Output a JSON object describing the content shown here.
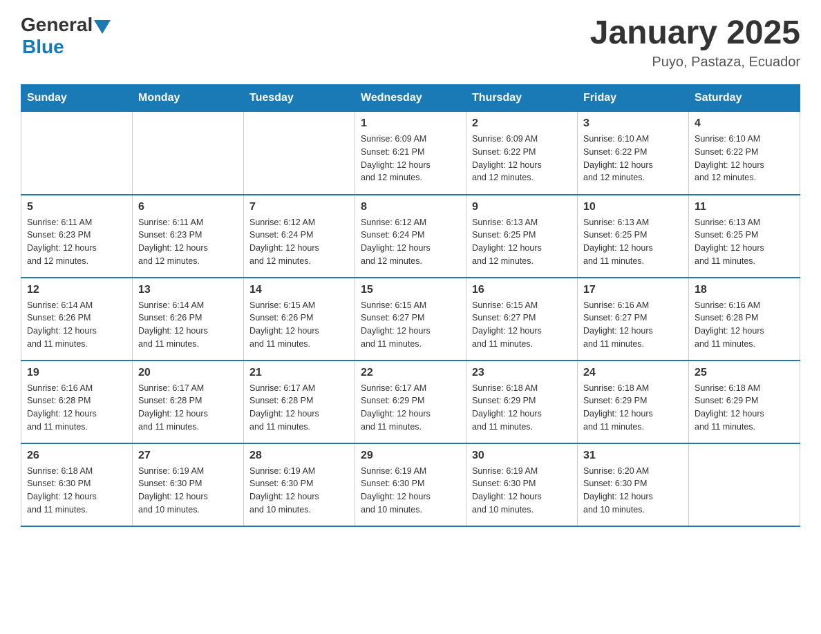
{
  "header": {
    "logo_general": "General",
    "logo_blue": "Blue",
    "title": "January 2025",
    "subtitle": "Puyo, Pastaza, Ecuador"
  },
  "days_of_week": [
    "Sunday",
    "Monday",
    "Tuesday",
    "Wednesday",
    "Thursday",
    "Friday",
    "Saturday"
  ],
  "weeks": [
    {
      "days": [
        {
          "number": "",
          "info": ""
        },
        {
          "number": "",
          "info": ""
        },
        {
          "number": "",
          "info": ""
        },
        {
          "number": "1",
          "info": "Sunrise: 6:09 AM\nSunset: 6:21 PM\nDaylight: 12 hours\nand 12 minutes."
        },
        {
          "number": "2",
          "info": "Sunrise: 6:09 AM\nSunset: 6:22 PM\nDaylight: 12 hours\nand 12 minutes."
        },
        {
          "number": "3",
          "info": "Sunrise: 6:10 AM\nSunset: 6:22 PM\nDaylight: 12 hours\nand 12 minutes."
        },
        {
          "number": "4",
          "info": "Sunrise: 6:10 AM\nSunset: 6:22 PM\nDaylight: 12 hours\nand 12 minutes."
        }
      ]
    },
    {
      "days": [
        {
          "number": "5",
          "info": "Sunrise: 6:11 AM\nSunset: 6:23 PM\nDaylight: 12 hours\nand 12 minutes."
        },
        {
          "number": "6",
          "info": "Sunrise: 6:11 AM\nSunset: 6:23 PM\nDaylight: 12 hours\nand 12 minutes."
        },
        {
          "number": "7",
          "info": "Sunrise: 6:12 AM\nSunset: 6:24 PM\nDaylight: 12 hours\nand 12 minutes."
        },
        {
          "number": "8",
          "info": "Sunrise: 6:12 AM\nSunset: 6:24 PM\nDaylight: 12 hours\nand 12 minutes."
        },
        {
          "number": "9",
          "info": "Sunrise: 6:13 AM\nSunset: 6:25 PM\nDaylight: 12 hours\nand 12 minutes."
        },
        {
          "number": "10",
          "info": "Sunrise: 6:13 AM\nSunset: 6:25 PM\nDaylight: 12 hours\nand 11 minutes."
        },
        {
          "number": "11",
          "info": "Sunrise: 6:13 AM\nSunset: 6:25 PM\nDaylight: 12 hours\nand 11 minutes."
        }
      ]
    },
    {
      "days": [
        {
          "number": "12",
          "info": "Sunrise: 6:14 AM\nSunset: 6:26 PM\nDaylight: 12 hours\nand 11 minutes."
        },
        {
          "number": "13",
          "info": "Sunrise: 6:14 AM\nSunset: 6:26 PM\nDaylight: 12 hours\nand 11 minutes."
        },
        {
          "number": "14",
          "info": "Sunrise: 6:15 AM\nSunset: 6:26 PM\nDaylight: 12 hours\nand 11 minutes."
        },
        {
          "number": "15",
          "info": "Sunrise: 6:15 AM\nSunset: 6:27 PM\nDaylight: 12 hours\nand 11 minutes."
        },
        {
          "number": "16",
          "info": "Sunrise: 6:15 AM\nSunset: 6:27 PM\nDaylight: 12 hours\nand 11 minutes."
        },
        {
          "number": "17",
          "info": "Sunrise: 6:16 AM\nSunset: 6:27 PM\nDaylight: 12 hours\nand 11 minutes."
        },
        {
          "number": "18",
          "info": "Sunrise: 6:16 AM\nSunset: 6:28 PM\nDaylight: 12 hours\nand 11 minutes."
        }
      ]
    },
    {
      "days": [
        {
          "number": "19",
          "info": "Sunrise: 6:16 AM\nSunset: 6:28 PM\nDaylight: 12 hours\nand 11 minutes."
        },
        {
          "number": "20",
          "info": "Sunrise: 6:17 AM\nSunset: 6:28 PM\nDaylight: 12 hours\nand 11 minutes."
        },
        {
          "number": "21",
          "info": "Sunrise: 6:17 AM\nSunset: 6:28 PM\nDaylight: 12 hours\nand 11 minutes."
        },
        {
          "number": "22",
          "info": "Sunrise: 6:17 AM\nSunset: 6:29 PM\nDaylight: 12 hours\nand 11 minutes."
        },
        {
          "number": "23",
          "info": "Sunrise: 6:18 AM\nSunset: 6:29 PM\nDaylight: 12 hours\nand 11 minutes."
        },
        {
          "number": "24",
          "info": "Sunrise: 6:18 AM\nSunset: 6:29 PM\nDaylight: 12 hours\nand 11 minutes."
        },
        {
          "number": "25",
          "info": "Sunrise: 6:18 AM\nSunset: 6:29 PM\nDaylight: 12 hours\nand 11 minutes."
        }
      ]
    },
    {
      "days": [
        {
          "number": "26",
          "info": "Sunrise: 6:18 AM\nSunset: 6:30 PM\nDaylight: 12 hours\nand 11 minutes."
        },
        {
          "number": "27",
          "info": "Sunrise: 6:19 AM\nSunset: 6:30 PM\nDaylight: 12 hours\nand 10 minutes."
        },
        {
          "number": "28",
          "info": "Sunrise: 6:19 AM\nSunset: 6:30 PM\nDaylight: 12 hours\nand 10 minutes."
        },
        {
          "number": "29",
          "info": "Sunrise: 6:19 AM\nSunset: 6:30 PM\nDaylight: 12 hours\nand 10 minutes."
        },
        {
          "number": "30",
          "info": "Sunrise: 6:19 AM\nSunset: 6:30 PM\nDaylight: 12 hours\nand 10 minutes."
        },
        {
          "number": "31",
          "info": "Sunrise: 6:20 AM\nSunset: 6:30 PM\nDaylight: 12 hours\nand 10 minutes."
        },
        {
          "number": "",
          "info": ""
        }
      ]
    }
  ]
}
